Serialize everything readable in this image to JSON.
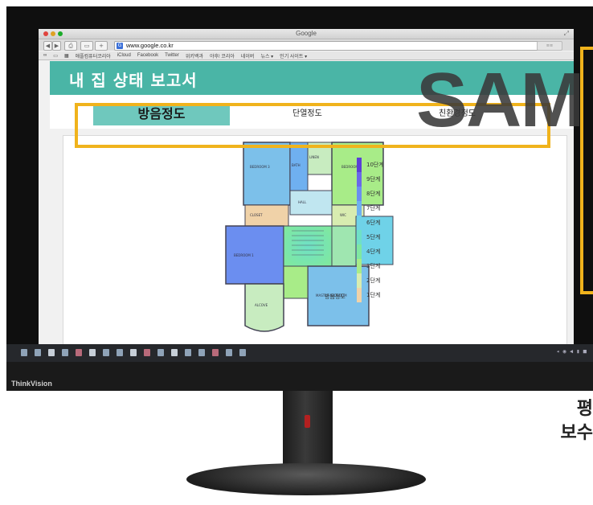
{
  "browser": {
    "window_title": "Google",
    "url": "www.google.co.kr",
    "reload_icon": "reload-icon",
    "bookmarks": [
      "애플컴퓨터코리아",
      "iCloud",
      "Facebook",
      "Twitter",
      "위키백과",
      "야후! 코리아",
      "네이버",
      "뉴스 ▾",
      "인기 사이트 ▾"
    ]
  },
  "page": {
    "title": "내 집 상태 보고서",
    "tabs": [
      {
        "label": "방음정도",
        "active": true
      },
      {
        "label": "단열정도",
        "active": false
      },
      {
        "label": "친환경정도",
        "active": false
      }
    ],
    "floorplan": {
      "rooms": [
        "BEDROOM 3",
        "BEDROOM 2",
        "BEDROOM 1",
        "BATH",
        "LINEN",
        "HALL",
        "CLOSET",
        "WIC",
        "ALCOVE",
        "MASTER BEDROOM"
      ]
    },
    "legend": {
      "title": "방음정도",
      "levels": [
        "10단계",
        "9단계",
        "8단계",
        "7단계",
        "6단계",
        "5단계",
        "4단계",
        "3단계",
        "2단계",
        "1단계"
      ],
      "colors": [
        "#5b3fd6",
        "#6a68e8",
        "#6b8ef0",
        "#6fb0f0",
        "#6fd2e8",
        "#6fe0c6",
        "#7fe8a0",
        "#a8ec88",
        "#d8ecb0",
        "#f0d2a8"
      ]
    }
  },
  "overlay": {
    "watermark": "SAM",
    "caption_line1": "평",
    "caption_line2": "보수",
    "highlight_color": "#f0b31c"
  },
  "monitor": {
    "brand": "ThinkVision",
    "tray": "◂ ◉ ◀ ▮ ■"
  }
}
